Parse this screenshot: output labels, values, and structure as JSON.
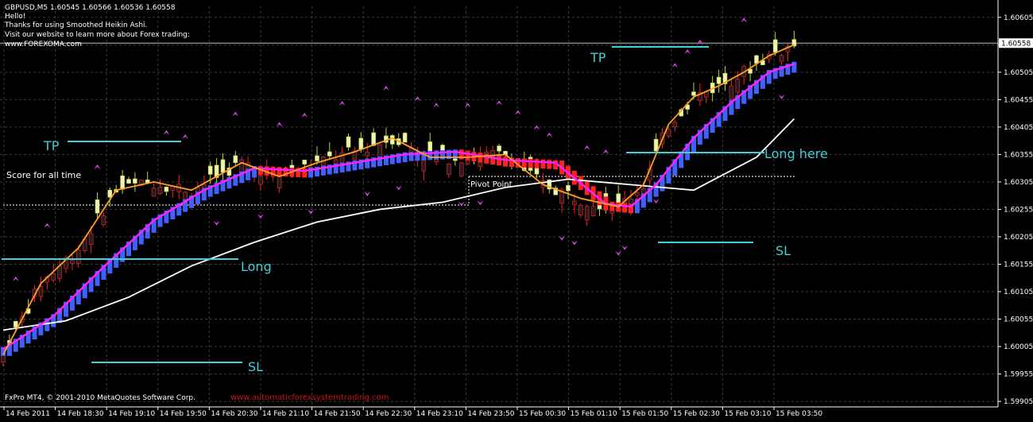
{
  "info": {
    "header": "GBPUSD,M5  1.60545 1.60566 1.60536 1.60558",
    "lines": [
      "Hello!",
      "Thanks for using Smoothed Heikin Ashi.",
      "Visit our website to learn more about Forex trading:",
      "www.FOREXOMA.com"
    ]
  },
  "score_label": "Score for all time",
  "pivot_label": "Pivot Point",
  "footer": {
    "copyright": "FxPro MT4, © 2001-2010 MetaQuotes Software Corp.",
    "watermark": "www.automaticforexsystemtrading.com"
  },
  "current_price": "1.60558",
  "annotations": {
    "tp_left": "TP",
    "long_left": "Long",
    "sl_left": "SL",
    "tp_right": "TP",
    "long_here": "Long here",
    "sl_right": "SL"
  },
  "colors": {
    "background": "#000000",
    "grid": "#3a3a3a",
    "axis_text": "#ffffff",
    "annotation": "#40d0d8",
    "bull_candle": "#f0f0b8",
    "bull_wick": "#b8d830",
    "ha_bull": "#4060ff",
    "ha_bear": "#ff2020",
    "ma_fast": "#ffa020",
    "ma_mid": "#ff20ff",
    "ma_slow": "#ffffff",
    "arrow": "#e040f0",
    "footer_red": "#d01010"
  },
  "chart_data": {
    "type": "line",
    "title": "GBPUSD,M5",
    "ohlc_last": {
      "open": 1.60545,
      "high": 1.60566,
      "low": 1.60536,
      "close": 1.60558
    },
    "x_ticks": [
      "14 Feb 2011",
      "14 Feb 18:30",
      "14 Feb 19:10",
      "14 Feb 19:50",
      "14 Feb 20:30",
      "14 Feb 21:10",
      "14 Feb 21:50",
      "14 Feb 22:30",
      "14 Feb 23:10",
      "14 Feb 23:50",
      "15 Feb 00:30",
      "15 Feb 01:10",
      "15 Feb 01:50",
      "15 Feb 02:30",
      "15 Feb 03:10",
      "15 Feb 03:50"
    ],
    "y_ticks": [
      "1.60605",
      "1.60555",
      "1.60505",
      "1.60455",
      "1.60405",
      "1.60355",
      "1.60305",
      "1.60255",
      "1.60205",
      "1.60155",
      "1.60105",
      "1.60055",
      "1.60005",
      "1.59955",
      "1.59905"
    ],
    "ylim": [
      1.59895,
      1.60625
    ],
    "grid": true,
    "series": [
      {
        "name": "",
        "color": "#ffffff",
        "x": [
          0,
          10,
          20,
          30,
          40,
          50,
          60,
          70,
          80,
          90,
          100,
          110,
          120,
          126
        ],
        "values": [
          1.60035,
          1.60052,
          1.60095,
          1.60152,
          1.60195,
          1.60232,
          1.60255,
          1.60268,
          1.60295,
          1.6031,
          1.603,
          1.6029,
          1.6035,
          1.6042
        ]
      },
      {
        "name": "",
        "color": "#ff20ff",
        "x": [
          0,
          8,
          16,
          24,
          32,
          40,
          48,
          56,
          64,
          72,
          80,
          88,
          96,
          100,
          104,
          110,
          116,
          122,
          126
        ],
        "values": [
          1.6,
          1.6006,
          1.6015,
          1.60235,
          1.6029,
          1.6033,
          1.60325,
          1.6034,
          1.60355,
          1.6036,
          1.60345,
          1.6034,
          1.60265,
          1.6026,
          1.603,
          1.60385,
          1.6045,
          1.60505,
          1.6052
        ]
      },
      {
        "name": "",
        "color": "#ffa020",
        "x": [
          0,
          6,
          12,
          18,
          24,
          30,
          38,
          44,
          50,
          56,
          62,
          68,
          74,
          80,
          86,
          92,
          98,
          102,
          106,
          110,
          114,
          118,
          122,
          126
        ],
        "values": [
          1.5999,
          1.6012,
          1.60185,
          1.6029,
          1.60305,
          1.6029,
          1.6034,
          1.60315,
          1.6034,
          1.6036,
          1.60385,
          1.6035,
          1.6035,
          1.60355,
          1.603,
          1.60275,
          1.6026,
          1.603,
          1.6041,
          1.6046,
          1.6048,
          1.60505,
          1.60535,
          1.60555
        ]
      }
    ]
  }
}
